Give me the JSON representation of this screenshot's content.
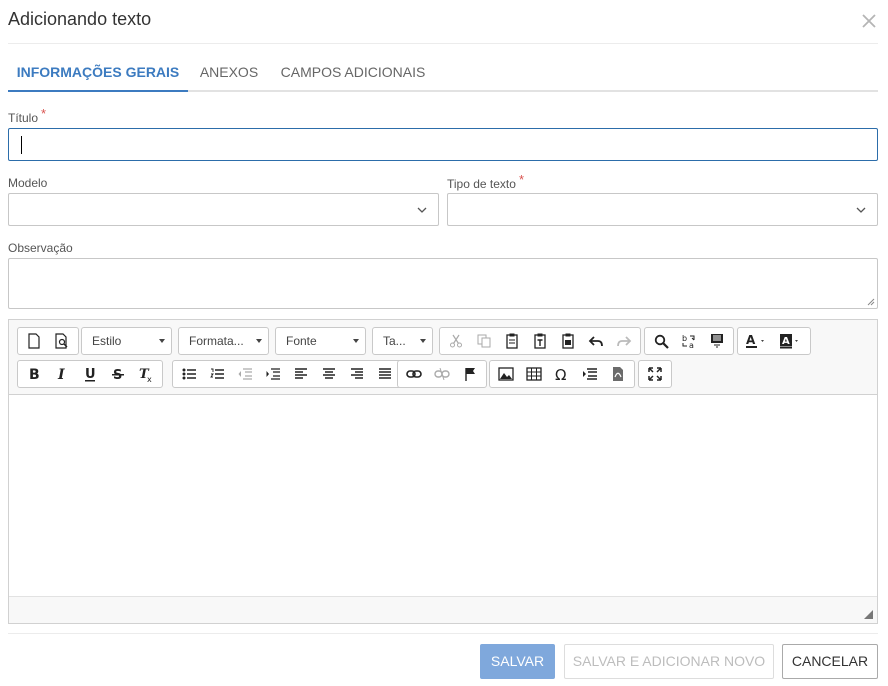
{
  "dialog": {
    "title": "Adicionando texto"
  },
  "tabs": [
    {
      "label": "INFORMAÇÕES GERAIS",
      "active": true
    },
    {
      "label": "ANEXOS",
      "active": false
    },
    {
      "label": "CAMPOS ADICIONAIS",
      "active": false
    }
  ],
  "form": {
    "titulo": {
      "label": "Título",
      "required_mark": "*",
      "value": ""
    },
    "modelo": {
      "label": "Modelo",
      "value": ""
    },
    "tipo_texto": {
      "label": "Tipo de texto",
      "required_mark": "*",
      "value": ""
    },
    "observacao": {
      "label": "Observação",
      "value": ""
    }
  },
  "editor": {
    "combos": {
      "estilo": "Estilo",
      "formato": "Formata...",
      "fonte": "Fonte",
      "tamanho": "Ta..."
    }
  },
  "footer": {
    "save": "SALVAR",
    "save_new": "SALVAR E ADICIONAR NOVO",
    "cancel": "CANCELAR"
  },
  "colors": {
    "accent": "#3c7bc0",
    "save_bg": "#7fa8dc",
    "required": "#d9534f"
  }
}
